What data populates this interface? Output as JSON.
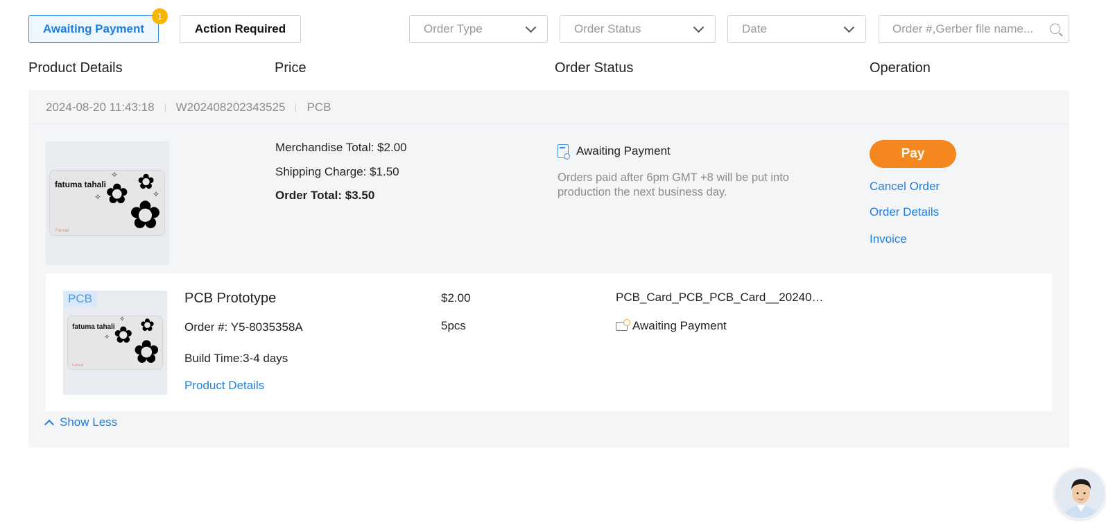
{
  "filters": {
    "tab_awaiting": "Awaiting Payment",
    "tab_awaiting_badge": "1",
    "tab_action": "Action Required",
    "order_type": "Order Type",
    "order_status": "Order Status",
    "date": "Date",
    "search_placeholder": "Order #,Gerber file name..."
  },
  "columns": {
    "product": "Product Details",
    "price": "Price",
    "status": "Order Status",
    "operation": "Operation"
  },
  "order": {
    "datetime": "2024-08-20 11:43:18",
    "number": "W202408202343525",
    "category": "PCB",
    "thumbnail_brand": "fatuma tahali",
    "thumbnail_footer": "Fatmail",
    "merchandise_total": "Merchandise Total: $2.00",
    "shipping_charge": "Shipping Charge: $1.50",
    "order_total": "Order Total: $3.50",
    "status": "Awaiting Payment",
    "status_note": "Orders paid after 6pm GMT +8 will be put into production the next business day.",
    "pay_label": "Pay",
    "cancel_label": "Cancel Order",
    "details_label": "Order Details",
    "invoice_label": "Invoice",
    "show_less": "Show Less"
  },
  "item": {
    "tag": "PCB",
    "title": "PCB Prototype",
    "order_no": "Order #: Y5-8035358A",
    "build_time": "Build Time:3-4 days",
    "details_link": "Product Details",
    "price": "$2.00",
    "qty": "5pcs",
    "file": "PCB_Card_PCB_PCB_Card__20240…",
    "status": "Awaiting Payment"
  },
  "colors": {
    "accent_blue": "#1f7fe0",
    "pay_orange": "#f5871f",
    "badge_yellow": "#f7b500"
  },
  "icons": [
    "chevron-down-icon",
    "search-icon",
    "document-search-icon",
    "wallet-clock-icon",
    "chevron-up-icon",
    "support-avatar"
  ]
}
